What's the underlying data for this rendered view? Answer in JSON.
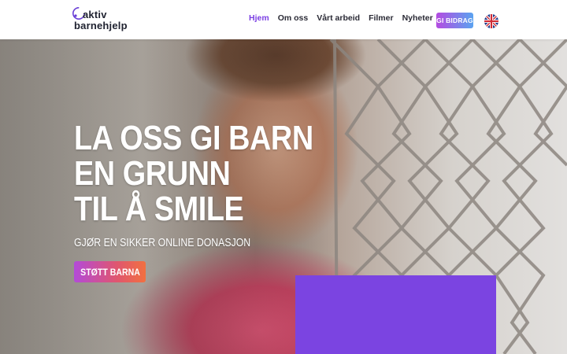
{
  "header": {
    "logo": {
      "line1": "aktiv",
      "line2": "barnehjelp"
    },
    "nav": [
      {
        "label": "Hjem",
        "active": true
      },
      {
        "label": "Om oss",
        "active": false
      },
      {
        "label": "Vårt arbeid",
        "active": false
      },
      {
        "label": "Filmer",
        "active": false
      },
      {
        "label": "Nyheter",
        "active": false
      }
    ],
    "donate_label": "GI BIDRAG",
    "language_icon": "uk-flag-icon"
  },
  "hero": {
    "headline": [
      "LA OSS GI BARN",
      "EN GRUNN",
      "TIL Å SMILE"
    ],
    "subheadline": "GJØR EN SIKKER ONLINE DONASJON",
    "cta_label": "STØTT BARNA"
  },
  "colors": {
    "accent": "#7b3fe4",
    "purple_box": "#7b44e1",
    "donate_gradient": [
      "#b44be1",
      "#5aa3f0"
    ],
    "cta_gradient": [
      "#b34ad8",
      "#f27040"
    ]
  }
}
